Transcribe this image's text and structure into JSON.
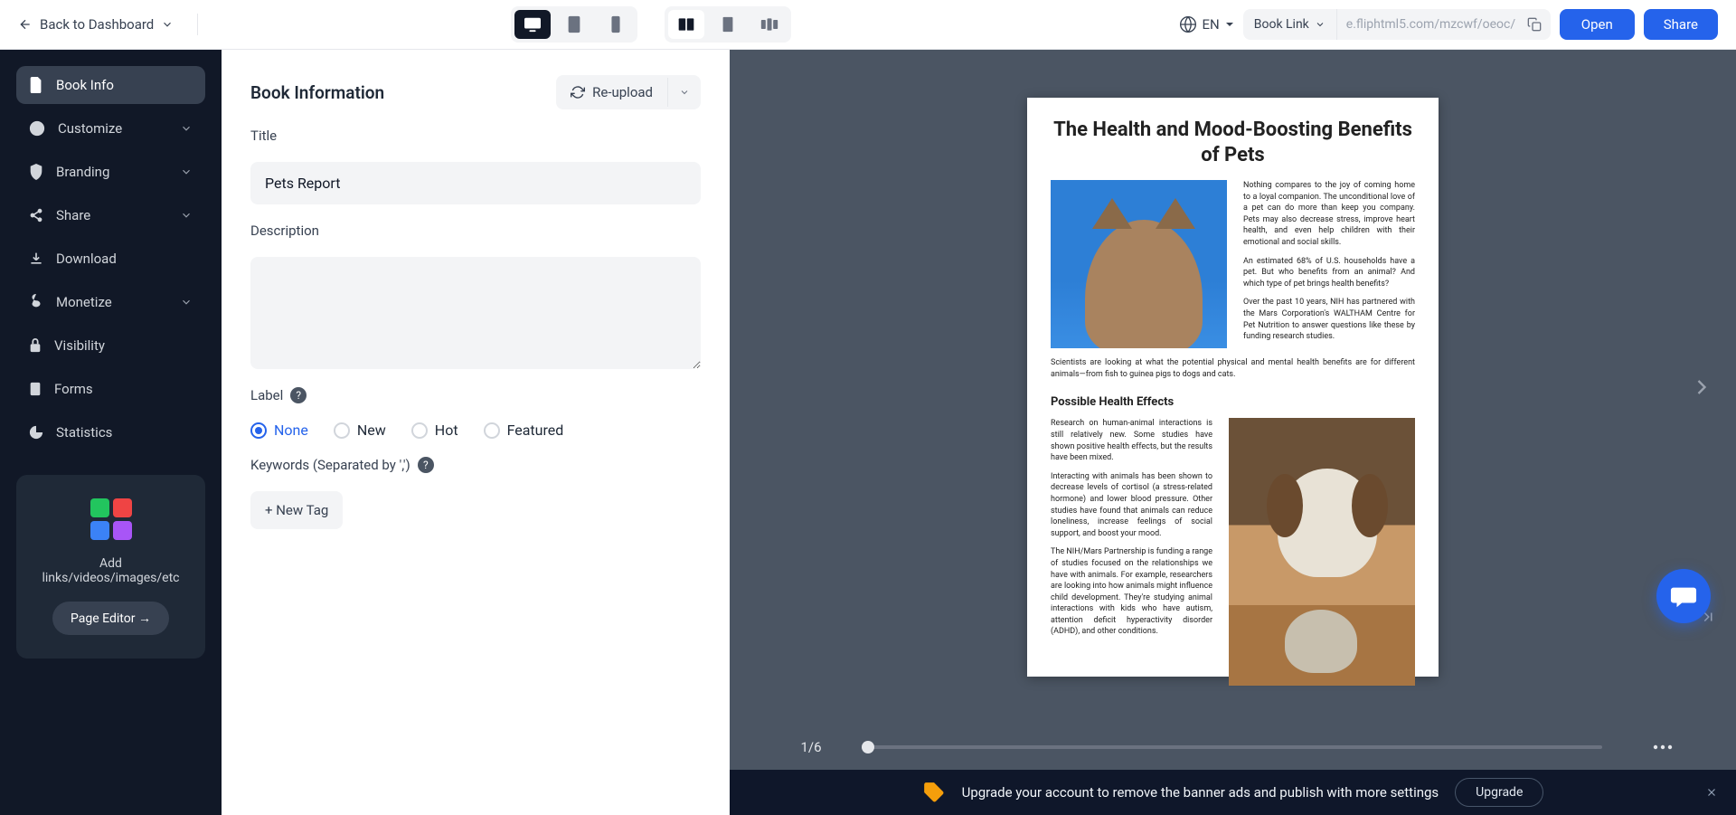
{
  "topbar": {
    "back": "Back to Dashboard",
    "lang": "EN",
    "link_type": "Book Link",
    "link_url": "e.fliphtml5.com/mzcwf/oeoc/",
    "open": "Open",
    "share": "Share"
  },
  "sidebar": {
    "items": [
      {
        "label": "Book Info"
      },
      {
        "label": "Customize"
      },
      {
        "label": "Branding"
      },
      {
        "label": "Share"
      },
      {
        "label": "Download"
      },
      {
        "label": "Monetize"
      },
      {
        "label": "Visibility"
      },
      {
        "label": "Forms"
      },
      {
        "label": "Statistics"
      }
    ],
    "promo_text": "Add links/videos/images/etc",
    "promo_btn": "Page Editor →"
  },
  "form": {
    "heading": "Book Information",
    "reupload": "Re-upload",
    "title_label": "Title",
    "title_value": "Pets Report",
    "desc_label": "Description",
    "desc_value": "",
    "label_label": "Label",
    "labels": {
      "none": "None",
      "new": "New",
      "hot": "Hot",
      "featured": "Featured"
    },
    "label_selected": "none",
    "keywords_label": "Keywords (Separated by ',')",
    "new_tag": "+ New Tag"
  },
  "preview": {
    "title": "The Health and Mood-Boosting Benefits of Pets",
    "p1": "Nothing compares to the joy of coming home to a loyal companion. The unconditional love of a pet can do more than keep you company. Pets may also decrease stress, improve heart health, and even help children with their emotional and social skills.",
    "p2": "An estimated 68% of U.S. households have a pet. But who benefits from an animal? And which type of pet brings health benefits?",
    "p3": "Over the past 10 years, NIH has partnered with the Mars Corporation's WALTHAM Centre for Pet Nutrition to answer questions like these by funding research studies.",
    "p4": "Scientists are looking at what the potential physical and mental health benefits are for different animals—from fish to guinea pigs to dogs and cats.",
    "h2": "Possible Health Effects",
    "p5": "Research on human-animal interactions is still relatively new. Some studies have shown positive health effects, but the results have been mixed.",
    "p6": "Interacting with animals has been shown to decrease levels of cortisol (a stress-related hormone) and lower blood pressure. Other studies have found that animals can reduce loneliness, increase feelings of social support, and boost your mood.",
    "p7": "The NIH/Mars Partnership is funding a range of studies focused on the relationships we have with animals. For example, researchers are looking into how animals might influence child development. They're studying animal interactions with kids who have autism, attention deficit hyperactivity disorder (ADHD), and other conditions.",
    "page_indicator": "1/6"
  },
  "upgrade": {
    "text": "Upgrade your account to remove the banner ads and publish with more settings",
    "btn": "Upgrade"
  }
}
